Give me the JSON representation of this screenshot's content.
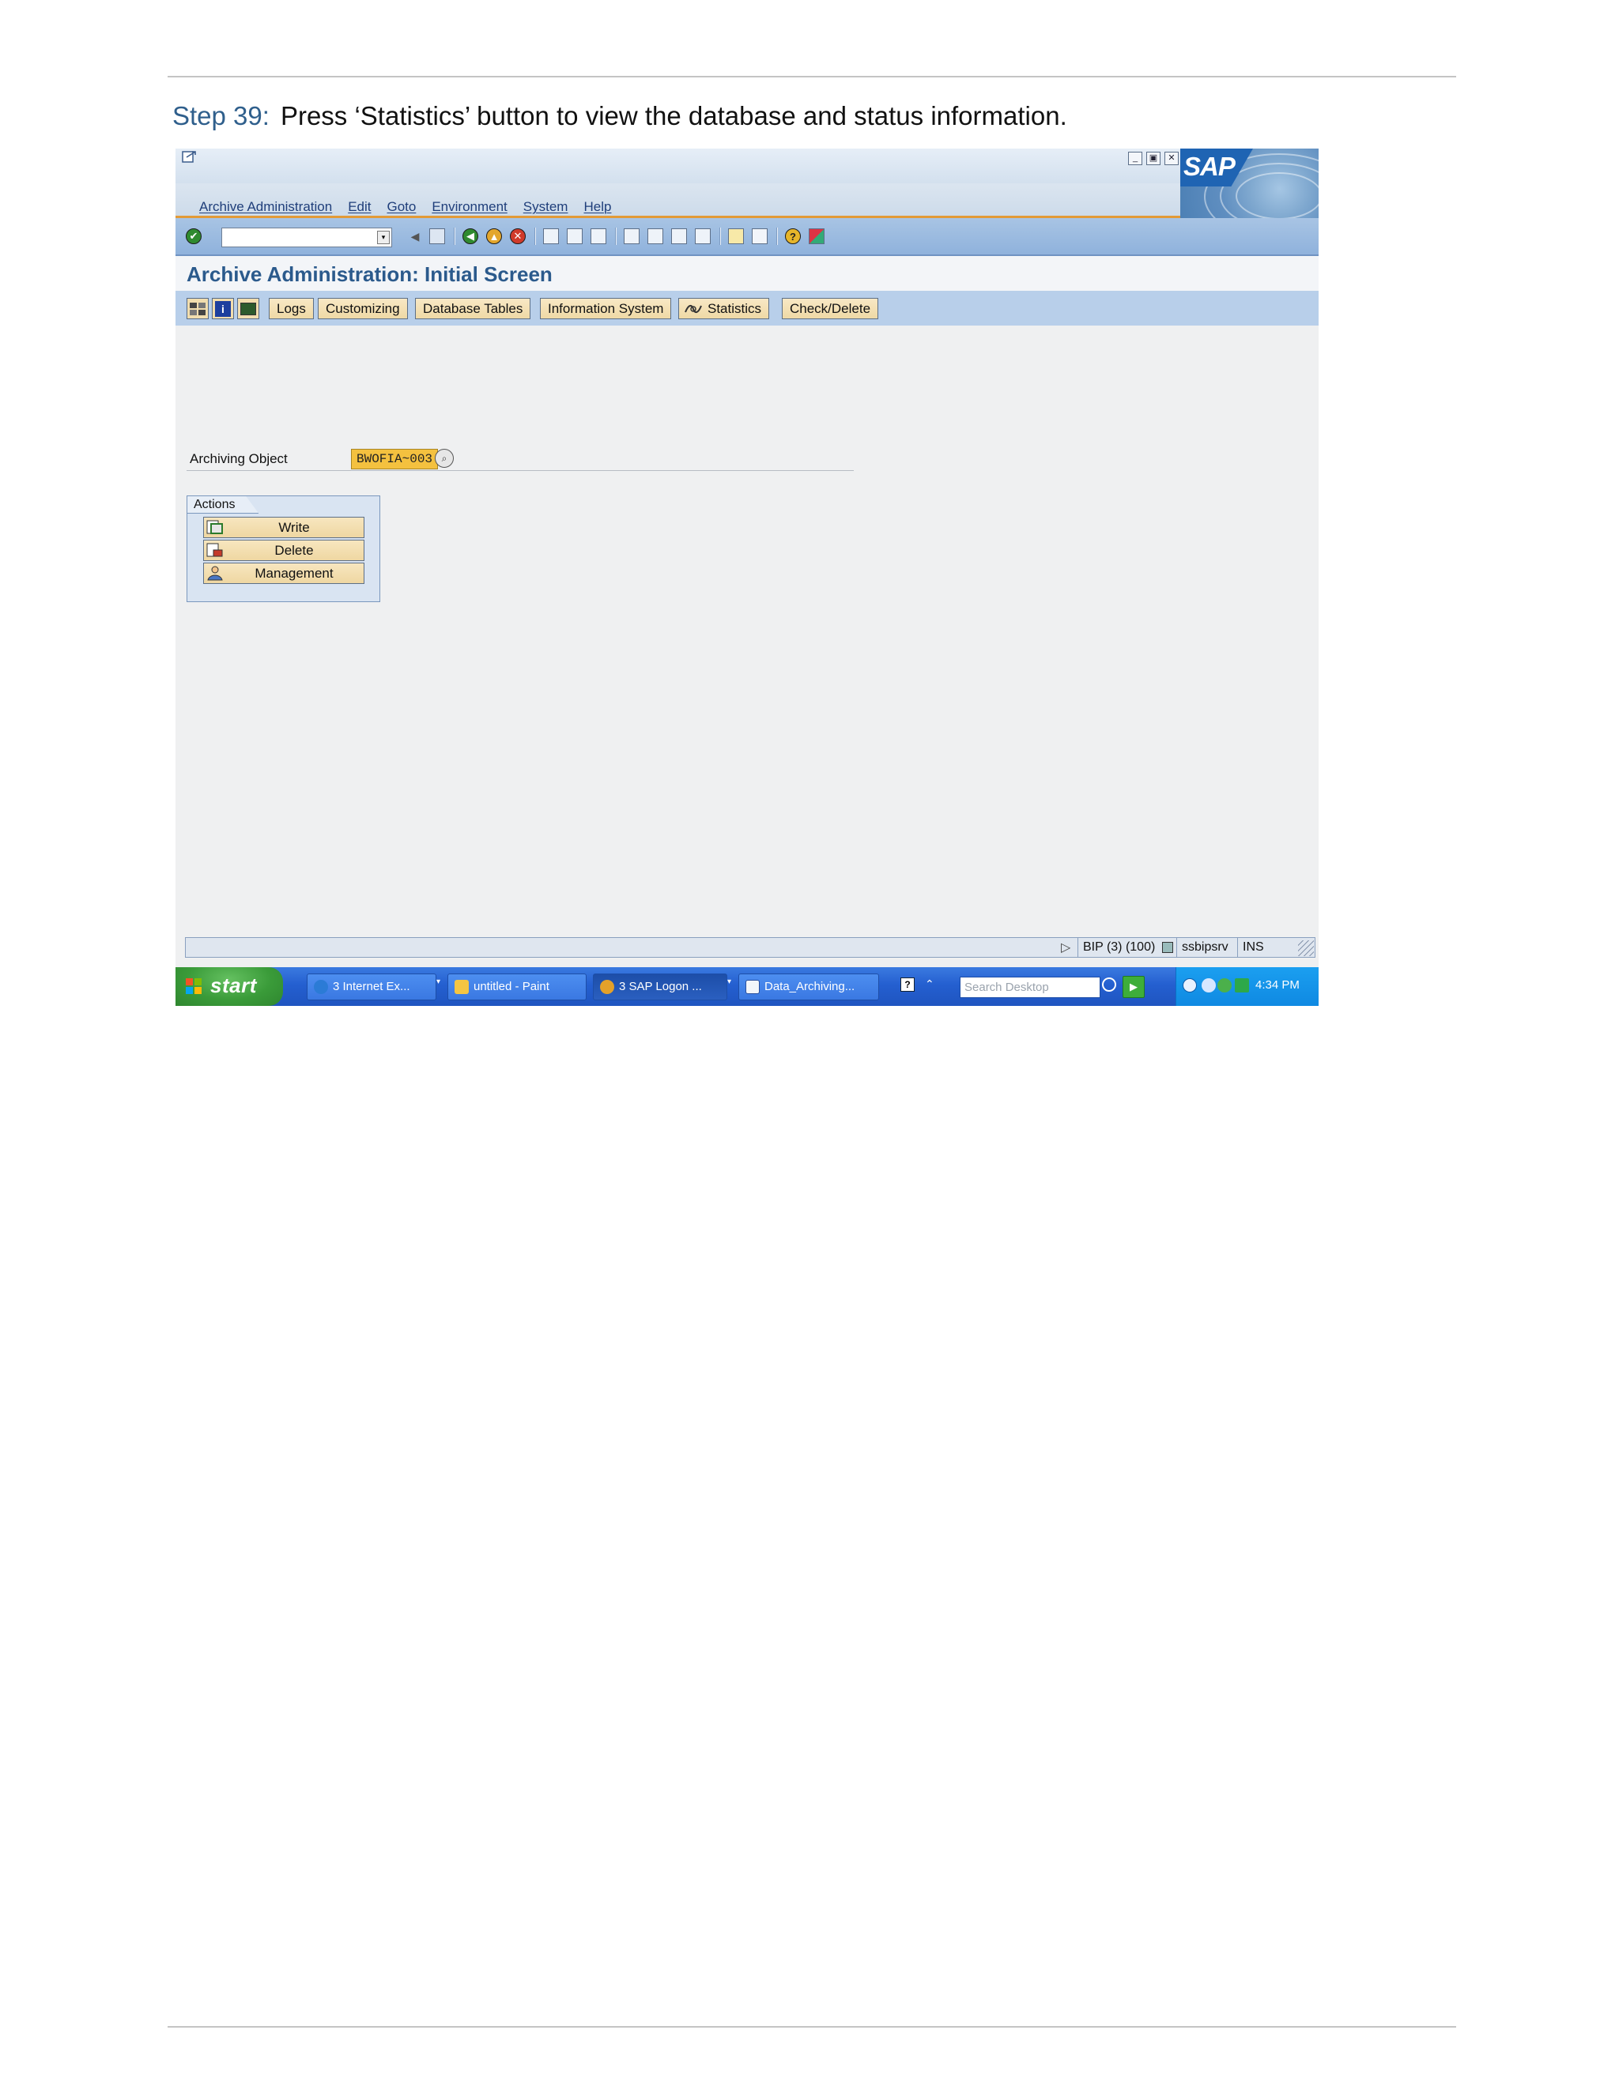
{
  "doc": {
    "step_label": "Step 39:",
    "step_text": "Press ‘Statistics’ button to view the database and status information."
  },
  "sap": {
    "logo_text": "SAP",
    "menu": [
      "Archive Administration",
      "Edit",
      "Goto",
      "Environment",
      "System",
      "Help"
    ],
    "window_controls": [
      "minimize",
      "restore",
      "close"
    ],
    "command_field_value": "",
    "page_title": "Archive Administration: Initial Screen",
    "app_toolbar": {
      "logs": "Logs",
      "customizing": "Customizing",
      "database_tables": "Database Tables",
      "information_system": "Information System",
      "statistics": "Statistics",
      "check_delete": "Check/Delete"
    },
    "archiving_object_label": "Archiving Object",
    "archiving_object_value": "BWOFIA~003",
    "actions": {
      "title": "Actions",
      "write": "Write",
      "delete": "Delete",
      "management": "Management"
    },
    "status": {
      "system": "BIP (3) (100)",
      "server": "ssbipsrv",
      "mode": "INS"
    },
    "icons": {
      "toolbar": [
        "enter-icon",
        "back-icon",
        "save-icon",
        "back-nav-icon",
        "exit-icon",
        "cancel-icon",
        "print-icon",
        "find-icon",
        "find-next-icon",
        "first-page-icon",
        "previous-page-icon",
        "next-page-icon",
        "last-page-icon",
        "create-session-icon",
        "shortcut-icon",
        "help-icon",
        "layout-icon"
      ]
    }
  },
  "taskbar": {
    "start": "start",
    "items": [
      "3 Internet Ex...",
      "untitled - Paint",
      "3 SAP Logon ...",
      "Data_Archiving..."
    ],
    "search_placeholder": "Search Desktop",
    "clock": "4:34 PM"
  },
  "colors": {
    "step_number": "#2f5f8c",
    "title": "#2b5a8c",
    "button_fill": "#f1ddae",
    "highlight_field": "#f4c13f",
    "toolbar_blue": "#8fb2dc",
    "taskbar_blue": "#245fd0"
  }
}
